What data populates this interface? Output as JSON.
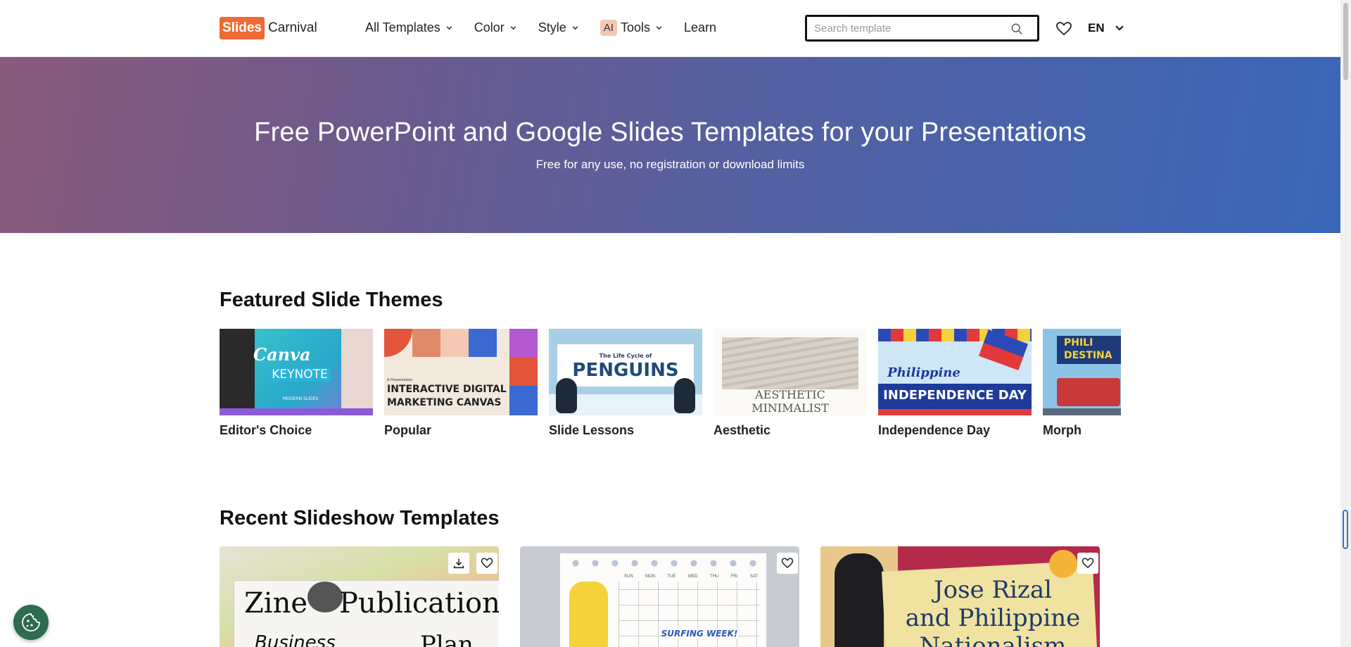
{
  "header": {
    "logo_box": "Slides",
    "logo_text": "Carnival",
    "nav": {
      "all_templates": "All Templates",
      "color": "Color",
      "style": "Style",
      "ai_badge": "AI",
      "tools": "Tools",
      "learn": "Learn"
    },
    "search_placeholder": "Search template",
    "lang": "EN"
  },
  "hero": {
    "title": "Free PowerPoint and Google Slides Templates for your Presentations",
    "subtitle": "Free for any use, no registration or download limits"
  },
  "featured": {
    "title": "Featured Slide Themes",
    "items": [
      {
        "label": "Editor's Choice",
        "thumb_text1": "Canva",
        "thumb_text2": "KEYNOTE",
        "thumb_text3": "MODERN SLIDES"
      },
      {
        "label": "Popular",
        "thumb_text1": "INTERACTIVE DIGITAL",
        "thumb_text2": "MARKETING CANVAS",
        "thumb_text3": "A Presentation"
      },
      {
        "label": "Slide Lessons",
        "thumb_text1": "The Life Cycle of",
        "thumb_text2": "PENGUINS"
      },
      {
        "label": "Aesthetic",
        "thumb_text1": "AESTHETIC MINIMALIST"
      },
      {
        "label": "Independence Day",
        "thumb_text1": "Philippine",
        "thumb_text2": "INDEPENDENCE DAY"
      },
      {
        "label": "Morph",
        "thumb_text1": "PHILI",
        "thumb_text2": "DESTINA"
      }
    ]
  },
  "recent": {
    "title": "Recent Slideshow Templates",
    "cards": [
      {
        "title_line1": "Zine",
        "title_line2": "Publication",
        "line3": "Business",
        "line4": "Plan"
      },
      {
        "title": "SURFING WEEK!",
        "days": [
          "SUN",
          "MON",
          "TUE",
          "WED",
          "THU",
          "FRI",
          "SAT"
        ]
      },
      {
        "title_line1": "Jose Rizal",
        "title_line2": "and Philippine",
        "title_line3": "Nationalism"
      }
    ]
  },
  "colors": {
    "brand": "#ef6b36",
    "hero_start": "#8a5a7a",
    "hero_end": "#3a66b8"
  }
}
